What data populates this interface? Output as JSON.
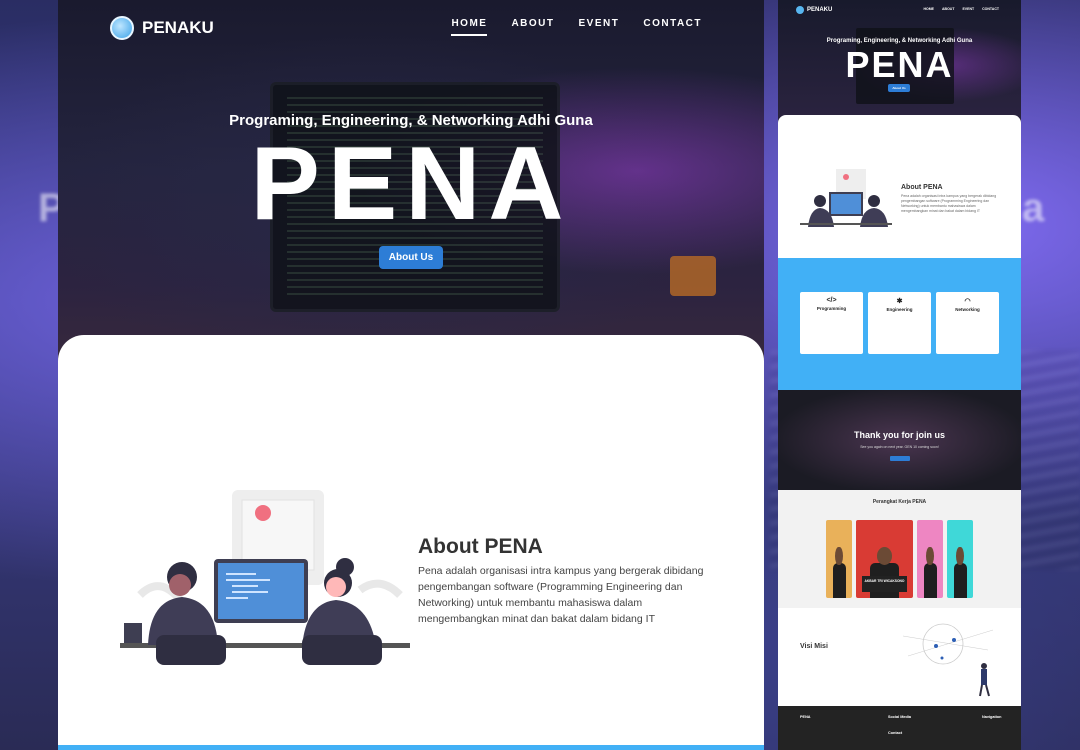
{
  "site": {
    "brand": "PENAKU",
    "nav": [
      "HOME",
      "ABOUT",
      "EVENT",
      "CONTACT"
    ],
    "active_nav": "HOME"
  },
  "hero": {
    "tagline": "Programing, Engineering, & Networking Adhi Guna",
    "title": "PENA",
    "cta": "About Us"
  },
  "about": {
    "title": "About PENA",
    "text": "Pena adalah organisasi intra kampus yang bergerak dibidang pengembangan software (Programming Engineering dan Networking) untuk membantu mahasiswa dalam mengembangkan minat dan bakat dalam bidang IT"
  },
  "backdrop": {
    "ghost_left": "P",
    "ghost_right": "a"
  },
  "preview": {
    "brand": "PENAKU",
    "nav": [
      "HOME",
      "ABOUT",
      "EVENT",
      "CONTACT"
    ],
    "tagline": "Programing, Engineering, & Networking Adhi Guna",
    "title": "PENA",
    "cta": "About Us",
    "about_title": "About PENA",
    "about_text": "Pena adalah organisasi intra kampus yang bergerak dibidang pengembangan software (Programming Engineering dan Networking) untuk membantu mahasiswa dalam mengembangkan minat dan bakat dalam bidang IT",
    "services": [
      {
        "icon": "</>",
        "title": "Programming"
      },
      {
        "icon": "✱",
        "title": "Engineering"
      },
      {
        "icon": "◠",
        "title": "Networking"
      }
    ],
    "join_title": "Thank you for join us",
    "join_sub": "See you again on next year. GEN 10 coming soon!",
    "team_title": "Perangkat Kerja PENA",
    "team_member_tag": "AKBAR TRI WICAKSONO",
    "visi_title": "Visi Misi",
    "footer_brand": "PENA",
    "footer_social": "Social Media",
    "footer_contact": "Contact",
    "footer_nav": "Navigation"
  },
  "colors": {
    "accent_blue": "#41b0f6",
    "button_blue": "#2d7dd6",
    "hero_dark": "#1a1a2e"
  }
}
